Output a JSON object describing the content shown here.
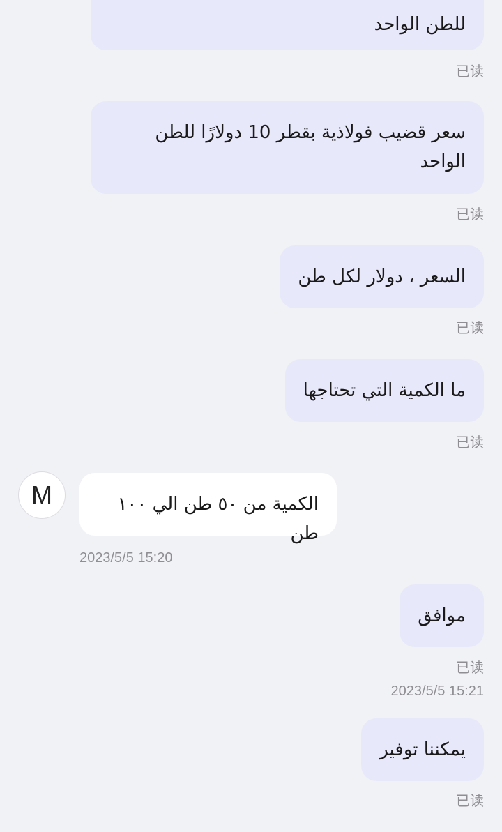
{
  "messages": [
    {
      "text": "للطن الواحد",
      "status": "已读"
    },
    {
      "text": "سعر قضيب فولاذية بقطر 10 دولارًا للطن الواحد",
      "status": "已读"
    },
    {
      "text": "السعر ، دولار لكل طن",
      "status": "已读"
    },
    {
      "text": "ما الكمية التي تحتاجها",
      "status": "已读"
    },
    {
      "sender_initial": "M",
      "text": "الكمية من ٥٠ طن الي ١٠٠ طن",
      "timestamp": "2023/5/5 15:20"
    },
    {
      "text": "موافق",
      "status": "已读",
      "timestamp": "2023/5/5 15:21"
    },
    {
      "text": "يمكننا توفير",
      "status": "已读"
    }
  ]
}
